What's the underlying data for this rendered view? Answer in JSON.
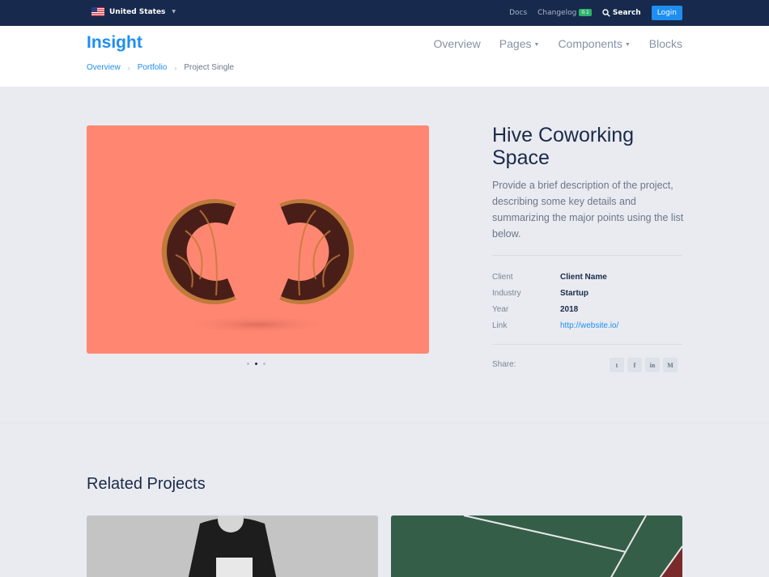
{
  "topbar": {
    "country": "United States",
    "links": {
      "docs": "Docs",
      "changelog": "Changelog",
      "changelog_badge": "0.1",
      "search": "Search",
      "login": "Login"
    }
  },
  "header": {
    "logo": "Insight",
    "nav": [
      "Overview",
      "Pages",
      "Components",
      "Blocks"
    ]
  },
  "breadcrumb": {
    "items": [
      "Overview",
      "Portfolio"
    ],
    "current": "Project Single",
    "separator": "›"
  },
  "project": {
    "title_line1": "Hive Coworking",
    "title_line2": "Space",
    "description": "Provide a brief description of the project, describing some key details and summarizing the major points using the list below.",
    "details": [
      {
        "label": "Client",
        "value": "Client Name"
      },
      {
        "label": "Industry",
        "value": "Startup"
      },
      {
        "label": "Year",
        "value": "2018"
      },
      {
        "label": "Link",
        "value": "http://website.io/"
      }
    ],
    "share_label": "Share:",
    "share_icons": [
      "twitter-icon",
      "facebook-icon",
      "linkedin-icon",
      "medium-icon"
    ],
    "share_glyphs": [
      "t",
      "f",
      "in",
      "M"
    ],
    "carousel": {
      "slides": 3,
      "active": 2
    }
  },
  "related": {
    "title": "Related Projects"
  },
  "colors": {
    "accent": "#1e8ef0",
    "topbar": "#172a4d",
    "hero_bg": "#ff8772",
    "badge": "#2db36b"
  }
}
